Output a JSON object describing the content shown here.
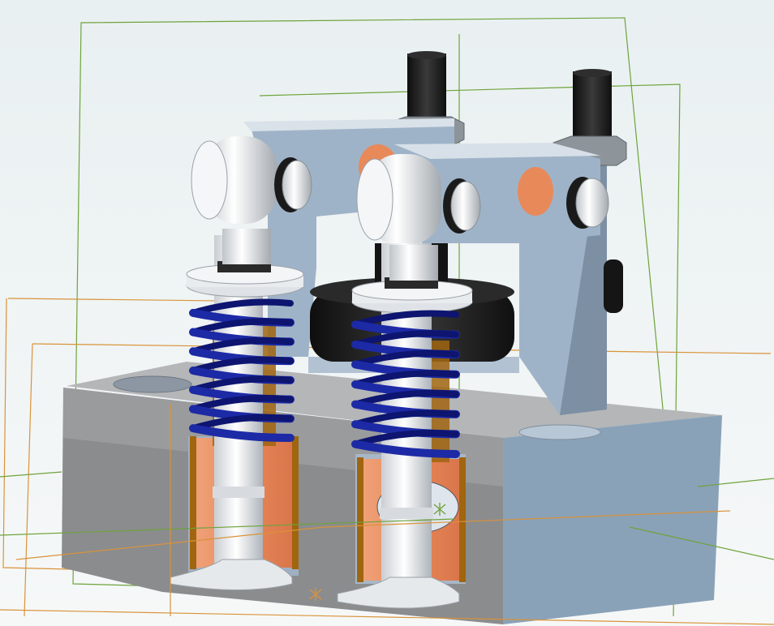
{
  "viewport": {
    "background_top": "#e9f0f1",
    "background_bottom": "#f6f8f8"
  },
  "colors": {
    "block_front": "#8b8c8e",
    "block_top": "#b4b6b8",
    "block_side": "#8aa2b8",
    "bracket": "#9fb3c8",
    "bracket_dark": "#7d8fa3",
    "spring": "#1d2aa6",
    "spring_dark": "#0d1570",
    "valve_stem": "#eef0f2",
    "valve_shade": "#c6cbd0",
    "guide_copper": "#e8895a",
    "guide_edge": "#a0650f",
    "black_part": "#1c1c1c",
    "nut": "#8d949a",
    "plane_green": "#6ea33c",
    "plane_orange": "#d9933a"
  },
  "icons": {
    "origin_marker_green": "origin-star-icon",
    "origin_marker_orange": "origin-star-icon"
  }
}
